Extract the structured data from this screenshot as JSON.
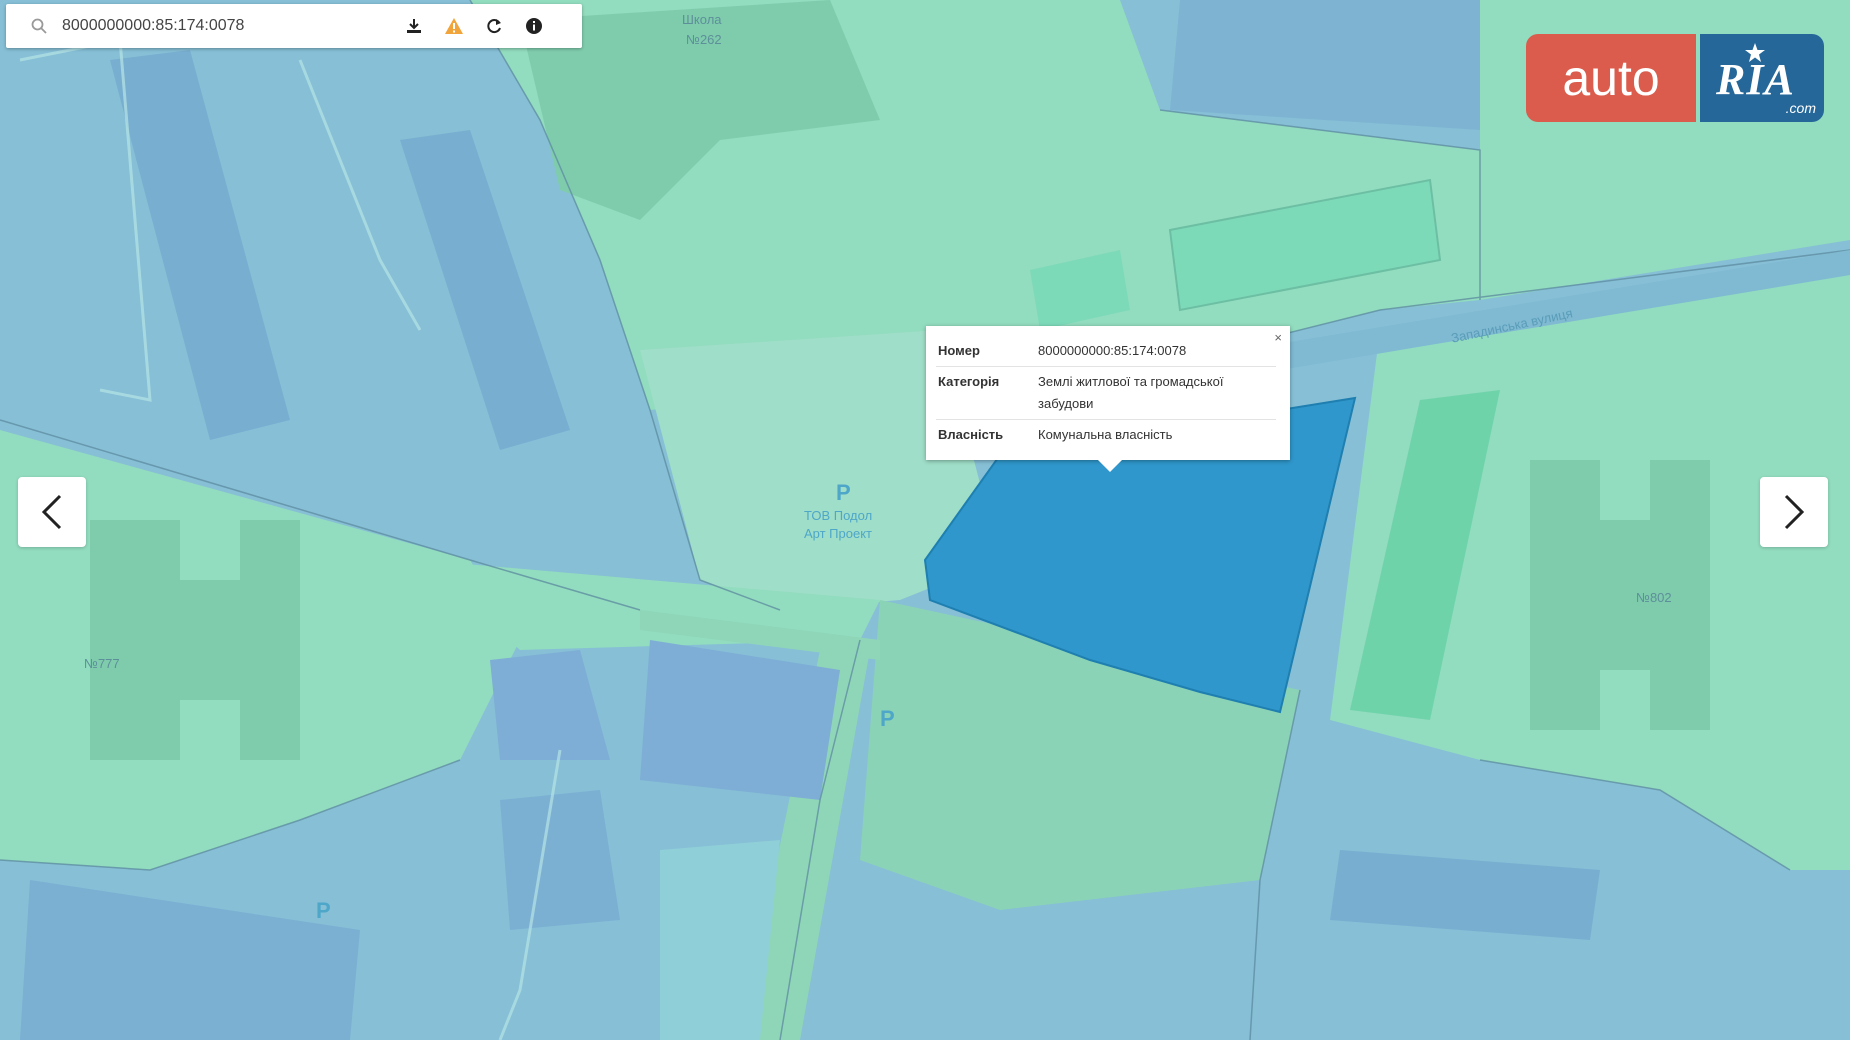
{
  "search": {
    "value": "8000000000:85:174:0078"
  },
  "toolbar": {
    "icons": [
      "search-icon",
      "download-icon",
      "warning-icon",
      "refresh-icon",
      "info-icon"
    ]
  },
  "popup": {
    "rows": [
      {
        "key": "Номер",
        "value": "8000000000:85:174:0078"
      },
      {
        "key": "Категорія",
        "value": "Землі житлової та громадської забудови"
      },
      {
        "key": "Власність",
        "value": "Комунальна власність"
      }
    ],
    "close_label": "×"
  },
  "map_labels": {
    "school": "Школа",
    "school_no": "№262",
    "street": "Западинська вулиця",
    "tov_line1": "ТОВ Подол",
    "tov_line2": "Арт Проект",
    "house_left": "№777",
    "house_right": "№802",
    "parking": "P"
  },
  "logo": {
    "auto": "auto",
    "ria": "RIA",
    "com": ".com"
  },
  "nav": {
    "prev_icon": "chevron-left-icon",
    "next_icon": "chevron-right-icon"
  },
  "colors": {
    "land_green": "#90dcba",
    "block_blue": "#86bfd6",
    "parcel_highlight": "#2f97cb",
    "logo_red": "#db5c4c",
    "logo_blue": "#256799"
  }
}
